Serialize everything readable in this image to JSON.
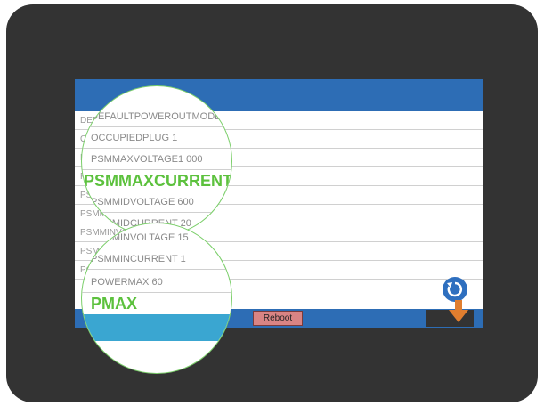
{
  "rows": [
    "DEFAULTPOWEROUTMODE",
    "OCCUPIEDPLUG 1",
    "PSMMAXVOLTAGE1000",
    "PSMMAXCURRENT",
    "PSMMIDVOLTAGE 600",
    "PSMMIDCURRENT 20",
    "PSMMINVOLTAGE 15",
    "PSMMINCURRENT 1",
    "POWERMAX 60"
  ],
  "zoom": {
    "top_rows": [
      "DEFAULTPOWEROUTMODE",
      "OCCUPIEDPLUG 1",
      "PSMMAXVOLTAGE1 000",
      "PSMMIDVOLTAGE 600",
      "PSMMIDCURRENT 20",
      "PSMMINVOLTAGE 15"
    ],
    "top_highlight": "PSMMAXCURRENT",
    "bottom_rows": [
      "PSMMINCURRENT 1",
      "POWERMAX 60"
    ],
    "bottom_highlight": "PMAX"
  },
  "buttons": {
    "reboot": "Reboot"
  },
  "icons": {
    "refresh": "refresh-icon",
    "download": "down-arrow-icon"
  },
  "colors": {
    "title_bar": "#2d6db5",
    "highlight_green": "#5cc13d",
    "reboot_bg": "#d98484",
    "arrow_orange": "#e07e2f"
  }
}
